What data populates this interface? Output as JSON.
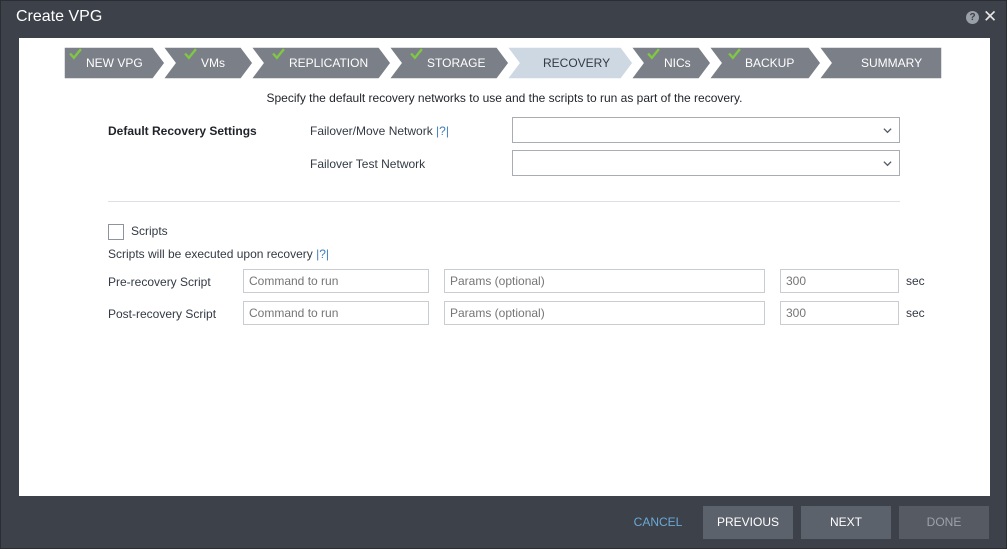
{
  "window": {
    "title": "Create VPG",
    "help_icon": "?",
    "close_icon": "✕"
  },
  "wizard": {
    "steps": [
      {
        "label": "NEW VPG",
        "state": "done"
      },
      {
        "label": "VMs",
        "state": "done"
      },
      {
        "label": "REPLICATION",
        "state": "done"
      },
      {
        "label": "STORAGE",
        "state": "done"
      },
      {
        "label": "RECOVERY",
        "state": "active"
      },
      {
        "label": "NICs",
        "state": "done"
      },
      {
        "label": "BACKUP",
        "state": "done"
      },
      {
        "label": "SUMMARY",
        "state": "pending"
      }
    ],
    "colors": {
      "done": "#7b7f87",
      "active": "#cdd8e2",
      "check": "#7fc843"
    }
  },
  "instruction": "Specify the default recovery networks to use and the scripts to run as part of the recovery.",
  "recovery": {
    "section_label": "Default Recovery Settings",
    "failover_label": "Failover/Move Network",
    "failover_help": "|?|",
    "failover_value": "",
    "test_label": "Failover Test Network",
    "test_value": ""
  },
  "scripts": {
    "checkbox_label": "Scripts",
    "checked": false,
    "note": "Scripts will be executed upon recovery",
    "note_help": "|?|",
    "pre": {
      "label": "Pre-recovery Script",
      "command_placeholder": "Command to run",
      "params_placeholder": "Params (optional)",
      "timeout_placeholder": "300",
      "unit": "sec"
    },
    "post": {
      "label": "Post-recovery Script",
      "command_placeholder": "Command to run",
      "params_placeholder": "Params (optional)",
      "timeout_placeholder": "300",
      "unit": "sec"
    }
  },
  "footer": {
    "cancel": "CANCEL",
    "previous": "PREVIOUS",
    "next": "NEXT",
    "done": "DONE"
  }
}
